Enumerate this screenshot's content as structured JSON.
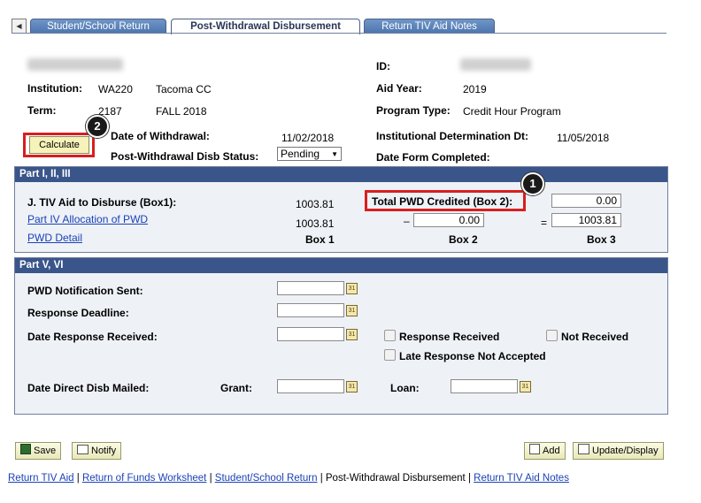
{
  "tabs": [
    {
      "label": "Student/School Return",
      "active": false
    },
    {
      "label": "Post-Withdrawal Disbursement",
      "active": true
    },
    {
      "label": "Return TIV Aid Notes",
      "active": false
    }
  ],
  "header": {
    "id_label": "ID:",
    "institution_label": "Institution:",
    "institution_code": "WA220",
    "institution_name": "Tacoma CC",
    "term_label": "Term:",
    "term_code": "2187",
    "term_name": "FALL 2018",
    "aid_year_label": "Aid Year:",
    "aid_year": "2019",
    "program_type_label": "Program Type:",
    "program_type": "Credit Hour Program",
    "calculate_label": "Calculate",
    "date_withdrawal_label": "Date of Withdrawal:",
    "date_withdrawal": "11/02/2018",
    "inst_det_label": "Institutional Determination Dt:",
    "inst_det_date": "11/05/2018",
    "status_label": "Post-Withdrawal Disb Status:",
    "status_value": "Pending",
    "date_form_completed_label": "Date Form Completed:"
  },
  "callouts": {
    "one": "1",
    "two": "2"
  },
  "part1": {
    "title": "Part I, II, III",
    "tiv_label": "J. TIV Aid to Disburse (Box1):",
    "tiv_value": "1003.81",
    "total_pwd_label": "Total PWD Credited (Box 2):",
    "total_pwd_value": "0.00",
    "alloc_link": "Part IV Allocation of PWD",
    "alloc_value": "1003.81",
    "minus": "–",
    "box2_value": "0.00",
    "equals": "=",
    "box3_value": "1003.81",
    "pwd_detail_link": "PWD Detail",
    "box1_label": "Box 1",
    "box2_label": "Box 2",
    "box3_label": "Box 3"
  },
  "part5": {
    "title": "Part V, VI",
    "notif_label": "PWD Notification Sent:",
    "deadline_label": "Response Deadline:",
    "received_label": "Date Response Received:",
    "resp_received_label": "Response Received",
    "not_received_label": "Not Received",
    "late_label": "Late Response Not Accepted",
    "direct_disb_label": "Date Direct Disb Mailed:",
    "grant_label": "Grant:",
    "loan_label": "Loan:",
    "calendar_glyph": "31"
  },
  "footer": {
    "save_label": "Save",
    "notify_label": "Notify",
    "add_label": "Add",
    "update_label": "Update/Display",
    "links": [
      "Return TIV Aid",
      "Return of Funds Worksheet",
      "Student/School Return",
      "Post-Withdrawal Disbursement",
      "Return TIV Aid Notes"
    ],
    "separator": " | "
  }
}
